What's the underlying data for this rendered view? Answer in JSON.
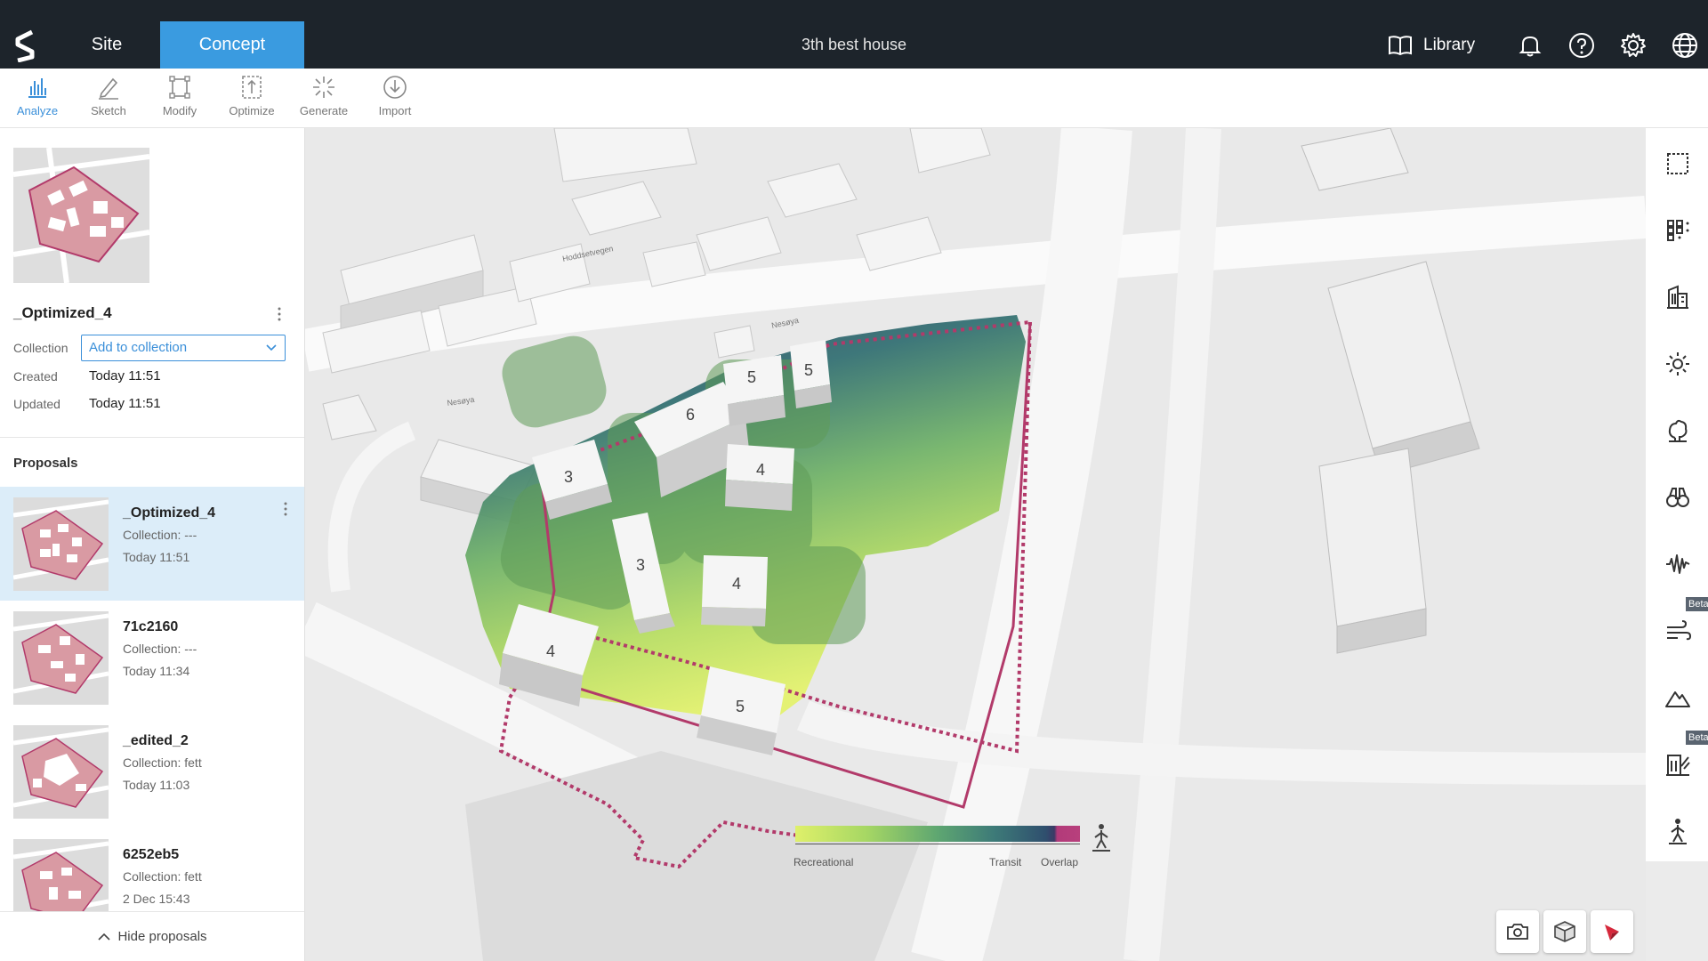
{
  "topbar": {
    "tabs": [
      {
        "label": "Site"
      },
      {
        "label": "Concept"
      }
    ],
    "project_title": "3th best house",
    "library_label": "Library"
  },
  "toolbar": {
    "tools": [
      {
        "label": "Analyze",
        "icon": "analyze-icon"
      },
      {
        "label": "Sketch",
        "icon": "sketch-icon"
      },
      {
        "label": "Modify",
        "icon": "modify-icon"
      },
      {
        "label": "Optimize",
        "icon": "optimize-icon"
      },
      {
        "label": "Generate",
        "icon": "generate-icon"
      },
      {
        "label": "Import",
        "icon": "import-icon"
      }
    ]
  },
  "current": {
    "name": "_Optimized_4",
    "collection_label": "Collection",
    "collection_placeholder": "Add to collection",
    "created_label": "Created",
    "created_value": "Today 11:51",
    "updated_label": "Updated",
    "updated_value": "Today 11:51"
  },
  "proposals": {
    "heading": "Proposals",
    "items": [
      {
        "name": "_Optimized_4",
        "collection": "Collection: ---",
        "time": "Today 11:51"
      },
      {
        "name": "71c2160",
        "collection": "Collection: ---",
        "time": "Today 11:34"
      },
      {
        "name": "_edited_2",
        "collection": "Collection: fett",
        "time": "Today 11:03"
      },
      {
        "name": "6252eb5",
        "collection": "Collection: fett",
        "time": "2 Dec 15:43"
      }
    ],
    "hide_label": "Hide proposals"
  },
  "map": {
    "buildings": [
      {
        "floors": "3"
      },
      {
        "floors": "6"
      },
      {
        "floors": "5"
      },
      {
        "floors": "5"
      },
      {
        "floors": "4"
      },
      {
        "floors": "3"
      },
      {
        "floors": "4"
      },
      {
        "floors": "4"
      },
      {
        "floors": "5"
      }
    ],
    "street_labels": [
      "Hoddsetvegen",
      "Nesøya",
      "Nesøya"
    ]
  },
  "legend": {
    "labels": [
      "Recreational",
      "Transit",
      "Overlap"
    ]
  },
  "right_toolbar": {
    "icons": [
      "select-rectangle-icon",
      "grid-icon",
      "building-icon",
      "sun-icon",
      "tree-icon",
      "view-binoculars-icon",
      "noise-wave-icon",
      "wind-icon",
      "terrain-icon",
      "daylight-icon",
      "pedestrian-icon"
    ],
    "badges": [
      "Beta",
      "Beta"
    ]
  },
  "colors": {
    "accent": "#3a9be0",
    "topbar": "#1d242b",
    "site_boundary": "#b23a6a"
  }
}
